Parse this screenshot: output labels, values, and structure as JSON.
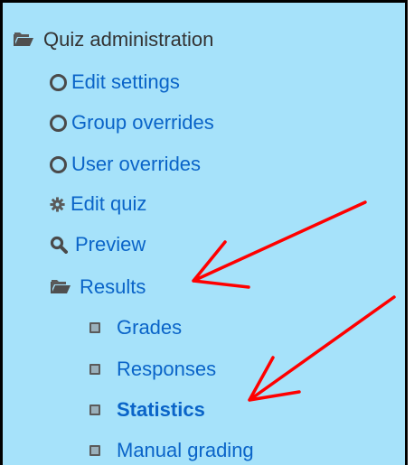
{
  "nav": {
    "root": {
      "label": "Quiz administration",
      "icon": "folder-open-icon"
    },
    "items": [
      {
        "label": "Edit settings",
        "icon": "circle-icon"
      },
      {
        "label": "Group overrides",
        "icon": "circle-icon"
      },
      {
        "label": "User overrides",
        "icon": "circle-icon"
      },
      {
        "label": "Edit quiz",
        "icon": "gear-icon"
      },
      {
        "label": "Preview",
        "icon": "magnifier-icon"
      },
      {
        "label": "Results",
        "icon": "folder-open-icon"
      }
    ],
    "results_children": [
      {
        "label": "Grades",
        "icon": "bullet-icon"
      },
      {
        "label": "Responses",
        "icon": "bullet-icon"
      },
      {
        "label": "Statistics",
        "icon": "bullet-icon",
        "current": true
      },
      {
        "label": "Manual grading",
        "icon": "bullet-icon"
      }
    ]
  },
  "colors": {
    "panel_bg": "#a6e2fa",
    "link": "#0a64c8",
    "arrow": "#ff0000"
  }
}
